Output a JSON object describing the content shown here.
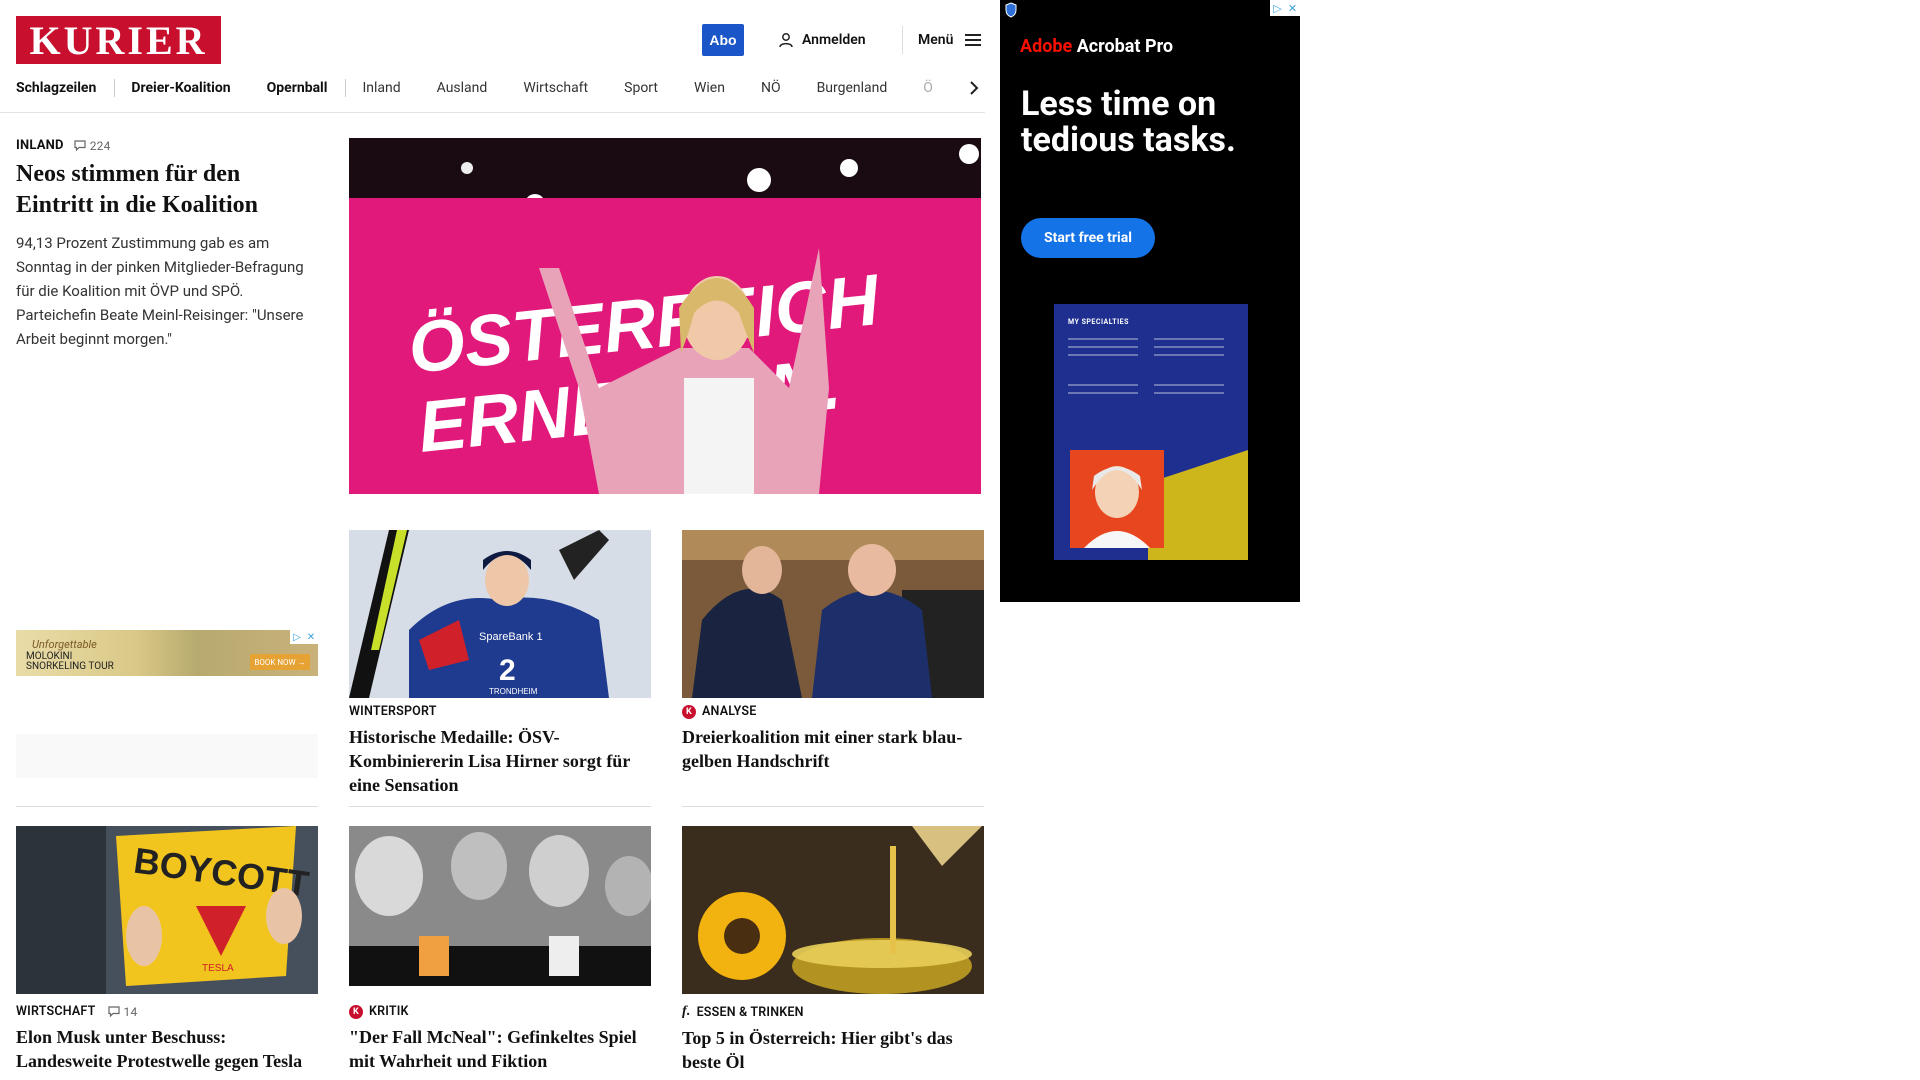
{
  "header": {
    "logo": "KURIER",
    "abo_label": "Abo",
    "login_label": "Anmelden",
    "menu_label": "Menü"
  },
  "nav": {
    "items": [
      "Schlagzeilen",
      "Dreier-Koalition",
      "Opernball",
      "Inland",
      "Ausland",
      "Wirtschaft",
      "Sport",
      "Wien",
      "NÖ",
      "Burgenland",
      "Ö"
    ]
  },
  "lead_story": {
    "kicker": "INLAND",
    "comments": "224",
    "title": "Neos stimmen für den Eintritt in die Koalition",
    "lead": "94,13 Prozent Zustimmung gab es am Sonntag in der pinken Mitglieder-Befragung für die Koalition mit ÖVP und SPÖ. Parteichefin Beate Meinl-Reisinger: \"Unsere Arbeit beginnt morgen.\"",
    "image_text_1": "ÖSTERREICH",
    "image_text_2": "ERNEUERN."
  },
  "stories": [
    {
      "kicker": "WINTERSPORT",
      "title": "Historische Medaille: ÖSV-Kombiniererin Lisa Hirner sorgt für eine Sensation",
      "badge": ""
    },
    {
      "kicker": "ANALYSE",
      "title": "Dreierkoalition mit einer stark blau-gelben Handschrift",
      "badge": "K"
    },
    {
      "kicker": "WIRTSCHAFT",
      "comments": "14",
      "title": "Elon Musk unter Beschuss: Landesweite Protestwelle gegen Tesla",
      "badge": ""
    },
    {
      "kicker": "KRITIK",
      "title": "\"Der Fall McNeal\": Gefinkeltes Spiel mit Wahrheit und Fiktion",
      "badge": "K"
    },
    {
      "kicker": "ESSEN & TRINKEN",
      "title": "Top 5 in Österreich: Hier gibt's das beste Öl",
      "badge": "f."
    }
  ],
  "image_texts": {
    "bib_sponsor": "SpareBank 1",
    "bib_number": "2",
    "bib_city": "TRONDHEIM",
    "boycott": "BOYCOTT",
    "tesla": "TESLA"
  },
  "ad": {
    "brand_1": "Adobe",
    "brand_2": " Acrobat Pro",
    "headline": "Less time on tedious tasks.",
    "cta": "Start free trial",
    "flyer_title": "MY SPECIALTIES"
  },
  "small_ad": {
    "line1": "Unforgettable",
    "line2": "MOLOKINI",
    "line3": "SNORKELING TOUR",
    "button": "BOOK NOW →"
  },
  "colors": {
    "brand_red": "#c8102e",
    "abo_blue": "#1a56c8",
    "ad_cta_blue": "#1473e6"
  }
}
